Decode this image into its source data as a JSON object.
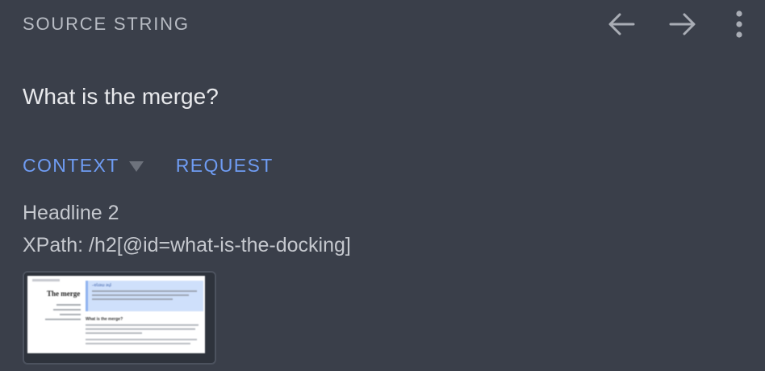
{
  "header": {
    "title": "SOURCE STRING",
    "back_icon": "arrow-left-icon",
    "forward_icon": "arrow-right-icon",
    "menu_icon": "more-vertical-icon"
  },
  "source": {
    "text": "What is the merge?"
  },
  "tabs": [
    {
      "label": "CONTEXT",
      "has_dropdown": true
    },
    {
      "label": "REQUEST",
      "has_dropdown": false
    }
  ],
  "context": {
    "element_type": "Headline 2",
    "xpath": "XPath: /h2[@id=what-is-the-docking]"
  },
  "screenshot_thumbnail": {
    "heading": "The merge",
    "banner_title": "–ɐʇɹǝɯ ǝɥʇ",
    "subheading": "What is the merge?"
  },
  "colors": {
    "background": "#3a3f4a",
    "accent": "#6f9cf3",
    "muted_text": "#b8bcc4",
    "primary_text": "#e8e9ec"
  }
}
